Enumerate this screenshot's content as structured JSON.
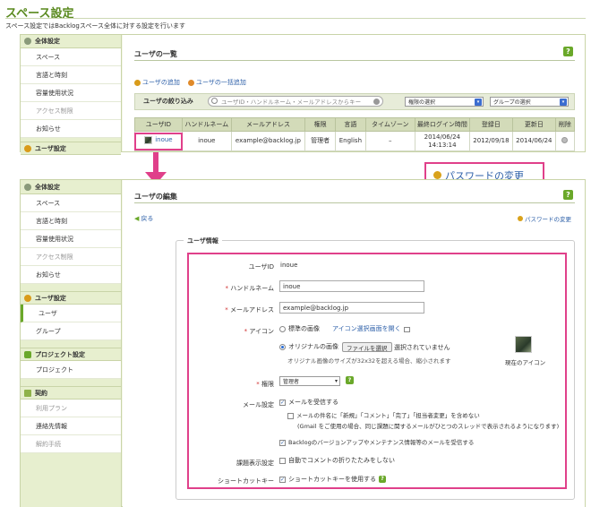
{
  "header": {
    "title": "スペース設定",
    "description": "スペース設定ではBacklogスペース全体に対する設定を行います"
  },
  "sidebar": {
    "general": {
      "title": "全体設定",
      "items": [
        "スペース",
        "言語と時刻",
        "容量使用状況",
        "アクセス制限",
        "お知らせ"
      ]
    },
    "user": {
      "title": "ユーザ設定",
      "items": [
        "ユーザ",
        "グループ"
      ]
    },
    "project": {
      "title": "プロジェクト設定",
      "items": [
        "プロジェクト"
      ]
    },
    "contract": {
      "title": "契約",
      "items": [
        "利用プラン",
        "連絡先情報",
        "解約手続"
      ]
    }
  },
  "user_list": {
    "title": "ユーザの一覧",
    "help": "?",
    "add_user": "ユーザの追加",
    "bulk_add": "ユーザの一括追加",
    "filter_label": "ユーザの絞り込み",
    "search_placeholder": "ユーザID・ハンドルネーム・メールアドレスからキー",
    "role_select": "権限の選択",
    "group_select": "グループの選択",
    "columns": [
      "ユーザID",
      "ハンドルネーム",
      "メールアドレス",
      "権限",
      "言語",
      "タイムゾーン",
      "最終ログイン時間",
      "登録日",
      "更新日",
      "削除"
    ],
    "row": {
      "user_id": "inoue",
      "handle": "inoue",
      "email": "example@backlog.jp",
      "role": "管理者",
      "lang": "English",
      "tz": "–",
      "last_login_date": "2014/06/24",
      "last_login_time": "14:13:14",
      "registered": "2012/09/18",
      "updated": "2014/06/24"
    }
  },
  "callout": {
    "label": "パスワードの変更"
  },
  "user_edit": {
    "title": "ユーザの編集",
    "help": "?",
    "back": "戻る",
    "password_change": "パスワードの変更",
    "legend": "ユーザ情報",
    "user_id_label": "ユーザID",
    "user_id_value": "inoue",
    "handle_label": "ハンドルネーム",
    "handle_value": "inoue",
    "email_label": "メールアドレス",
    "email_value": "example@backlog.jp",
    "icon_label": "アイコン",
    "icon_standard": "標準の画像",
    "icon_select_link": "アイコン選択画面を開く",
    "icon_original": "オリジナルの画像",
    "file_button": "ファイルを選択",
    "file_status": "選択されていません",
    "icon_note": "オリジナル画像のサイズが32x32を超える場合、縮小されます",
    "current_icon": "現在のアイコン",
    "role_label": "権限",
    "role_value": "管理者",
    "mail_label": "メール設定",
    "mail_receive": "メールを受信する",
    "mail_subject_opt": "メールの件名に「新規」「コメント」「完了」「担当者変更」を含めない",
    "mail_subject_note": "(Gmail をご使用の場合、同じ課題に関するメールがひとつのスレッドで表示されるようになります)",
    "mail_backlog": "Backlogのバージョンアップやメンテナンス情報等のメールを受信する",
    "issue_label": "課題表示設定",
    "issue_value": "自動でコメントの折りたたみをしない",
    "shortcut_label": "ショートカットキー",
    "shortcut_value": "ショートカットキーを使用する",
    "required_mark": "*"
  }
}
